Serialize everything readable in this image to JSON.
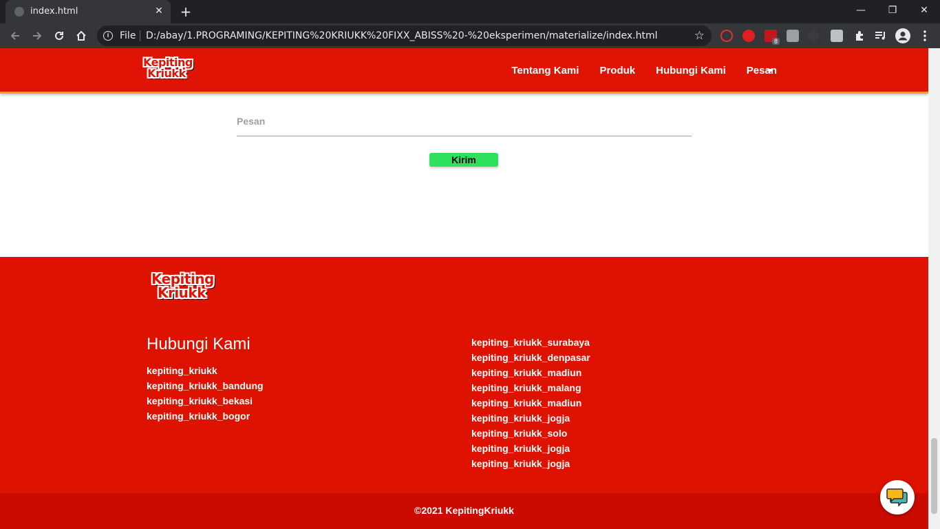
{
  "browser": {
    "tab_title": "index.html",
    "tab_close": "✕",
    "new_tab": "+",
    "window": {
      "minimize": "—",
      "restore": "❐",
      "close": "✕"
    },
    "omnibox": {
      "scheme_label": "File",
      "url": "D:/abay/1.PROGRAMING/KEPITING%20KRIUKK%20FIXX_ABISS%20-%20eksperimen/materialize/index.html"
    },
    "extension_badge": "8"
  },
  "nav": {
    "logo": [
      "Kepiting",
      "Kriukk"
    ],
    "links": [
      "Tentang Kami",
      "Produk",
      "Hubungi Kami",
      "Pesan"
    ]
  },
  "form": {
    "message_label": "Pesan",
    "submit_label": "Kirim"
  },
  "footer": {
    "logo": [
      "Kepiting",
      "Kriukk"
    ],
    "title": "Hubungi Kami",
    "left_links": [
      "kepiting_kriukk",
      "kepiting_kriukk_bandung",
      "kepiting_kriukk_bekasi",
      "kepiting_kriukk_bogor"
    ],
    "right_links": [
      "kepiting_kriukk_surabaya",
      "kepiting_kriukk_denpasar",
      "kepiting_kriukk_madiun",
      "kepiting_kriukk_malang",
      "kepiting_kriukk_madiun",
      "kepiting_kriukk_jogja",
      "kepiting_kriukk_solo",
      "kepiting_kriukk_jogja",
      "kepiting_kriukk_jogja"
    ],
    "copyright": "©2021 KepitingKriukk"
  },
  "colors": {
    "brand_red": "#e01405",
    "accent_green": "#2ee05c",
    "nav_border": "#f0a21a"
  }
}
